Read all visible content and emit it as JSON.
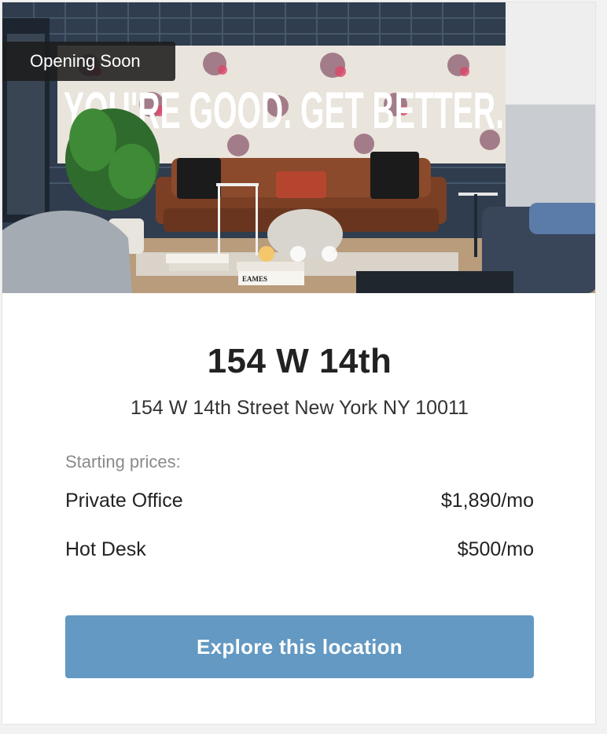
{
  "badge": {
    "label": "Opening Soon"
  },
  "hero": {
    "wall_slogan": "YOU'RE GOOD. GET BETTER.",
    "book_label": "EAMES",
    "slide_count": 3,
    "active_slide": 1
  },
  "location": {
    "name": "154 W 14th",
    "address": "154 W 14th Street New York NY 10011"
  },
  "pricing": {
    "label": "Starting prices:",
    "items": [
      {
        "name": "Private Office",
        "price": "$1,890/mo"
      },
      {
        "name": "Hot Desk",
        "price": "$500/mo"
      }
    ]
  },
  "cta": {
    "label": "Explore this location"
  },
  "colors": {
    "cta_background": "#6399c2",
    "badge_background": "#1c1c1c",
    "active_dot": "#f4c76b"
  }
}
